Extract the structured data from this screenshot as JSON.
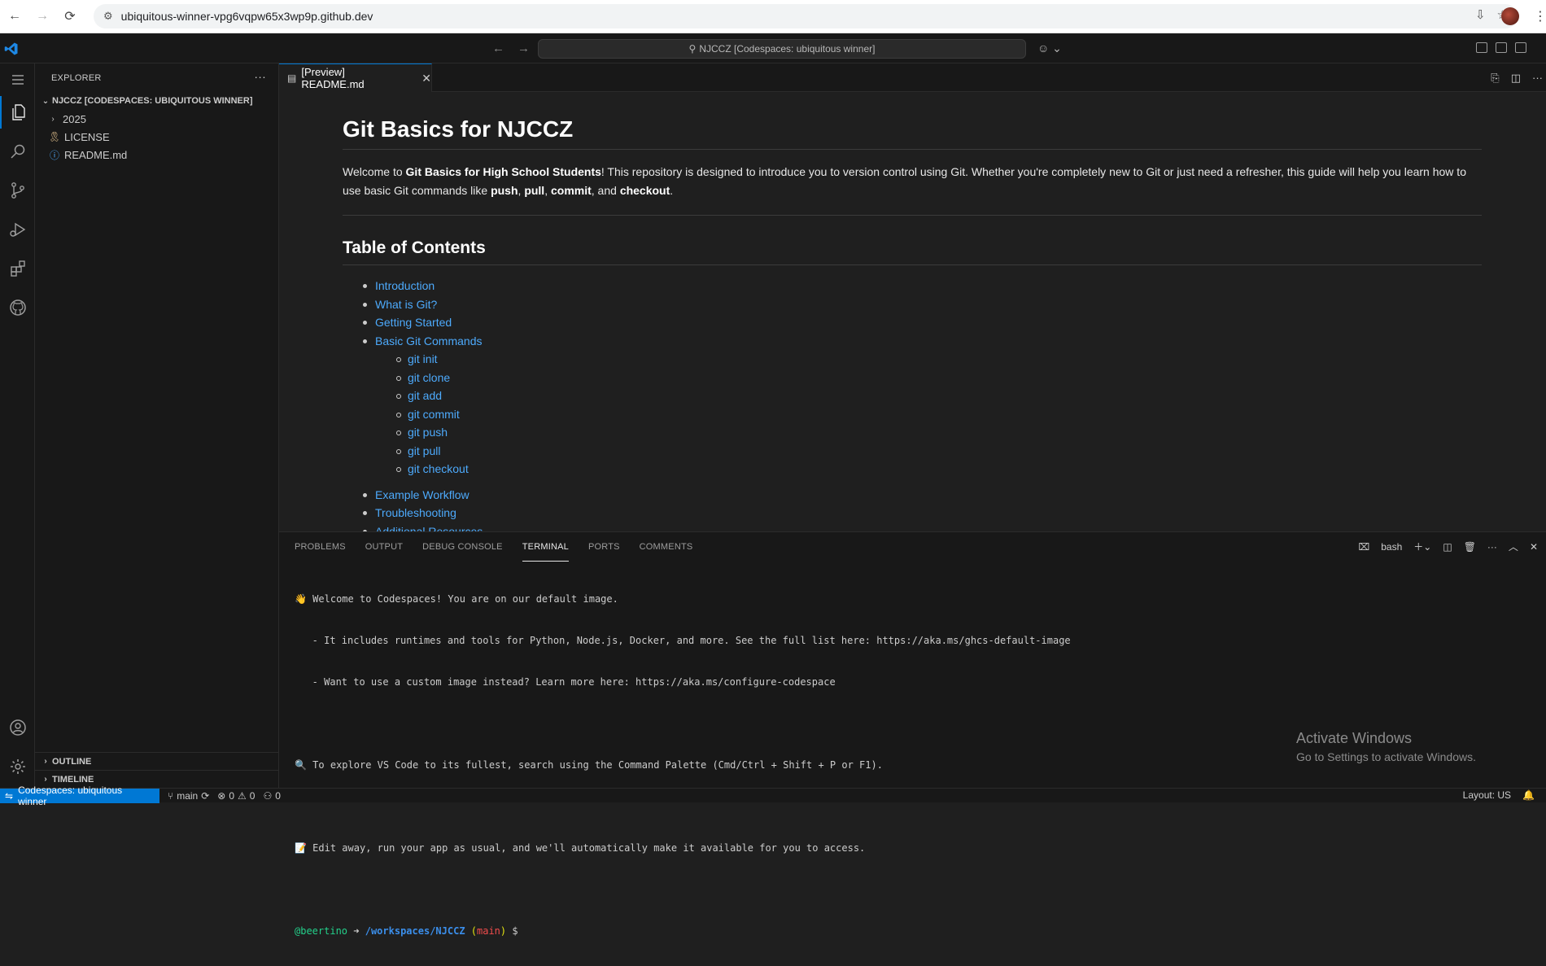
{
  "browser": {
    "url": "ubiquitous-winner-vpg6vqpw65x3wp9p.github.dev"
  },
  "titlebar": {
    "search_text": "NJCCZ [Codespaces: ubiquitous winner]"
  },
  "sidebar": {
    "header": "EXPLORER",
    "root": "NJCCZ [CODESPACES: UBIQUITOUS WINNER]",
    "items": [
      {
        "label": "2025",
        "kind": "folder"
      },
      {
        "label": "LICENSE",
        "kind": "file"
      },
      {
        "label": "README.md",
        "kind": "file"
      }
    ],
    "outline": "OUTLINE",
    "timeline": "TIMELINE"
  },
  "editor": {
    "tab_label": "[Preview] README.md",
    "doc": {
      "title": "Git Basics for NJCCZ",
      "intro_welcome": "Welcome to ",
      "intro_bold1": "Git Basics for High School Students",
      "intro_rest": "! This repository is designed to introduce you to version control using Git. Whether you're completely new to Git or just need a refresher, this guide will help you learn how to use basic Git commands like ",
      "cmd_push": "push",
      "comma1": ", ",
      "cmd_pull": "pull",
      "comma2": ", ",
      "cmd_commit": "commit",
      "and_text": ", and ",
      "cmd_checkout": "checkout",
      "period": ".",
      "toc_heading": "Table of Contents",
      "toc": {
        "introduction": "Introduction",
        "what_is_git": "What is Git?",
        "getting_started": "Getting Started",
        "basic_git_commands": "Basic Git Commands",
        "git_init": "git init",
        "git_clone": "git clone",
        "git_add": "git add",
        "git_commit": "git commit",
        "git_push": "git push",
        "git_pull": "git pull",
        "git_checkout": "git checkout",
        "example_workflow": "Example Workflow",
        "troubleshooting": "Troubleshooting",
        "additional_resources": "Additional Resources"
      }
    }
  },
  "panel": {
    "tabs": {
      "problems": "PROBLEMS",
      "output": "OUTPUT",
      "debug_console": "DEBUG CONSOLE",
      "terminal": "TERMINAL",
      "ports": "PORTS",
      "comments": "COMMENTS"
    },
    "shell_label": "bash",
    "terminal": {
      "line1": "👋 Welcome to Codespaces! You are on our default image.",
      "line2": "   - It includes runtimes and tools for Python, Node.js, Docker, and more. See the full list here: https://aka.ms/ghcs-default-image",
      "line3": "   - Want to use a custom image instead? Learn more here: https://aka.ms/configure-codespace",
      "line4": "🔍 To explore VS Code to its fullest, search using the Command Palette (Cmd/Ctrl + Shift + P or F1).",
      "line5": "📝 Edit away, run your app as usual, and we'll automatically make it available for you to access.",
      "prompt_user": "@beertino",
      "prompt_arrow": " ➜ ",
      "prompt_path": "/workspaces/NJCCZ",
      "prompt_branch_open": " (",
      "prompt_branch": "main",
      "prompt_branch_close": ")",
      "prompt_dollar": " $ "
    }
  },
  "watermark": {
    "title": "Activate Windows",
    "subtitle": "Go to Settings to activate Windows."
  },
  "statusbar": {
    "remote": "Codespaces: ubiquitous winner",
    "branch": "main",
    "errors": "0",
    "warnings": "0",
    "ports": "0",
    "layout": "Layout: US"
  },
  "colors": {
    "accent": "#0078d4",
    "link": "#4daafc"
  }
}
